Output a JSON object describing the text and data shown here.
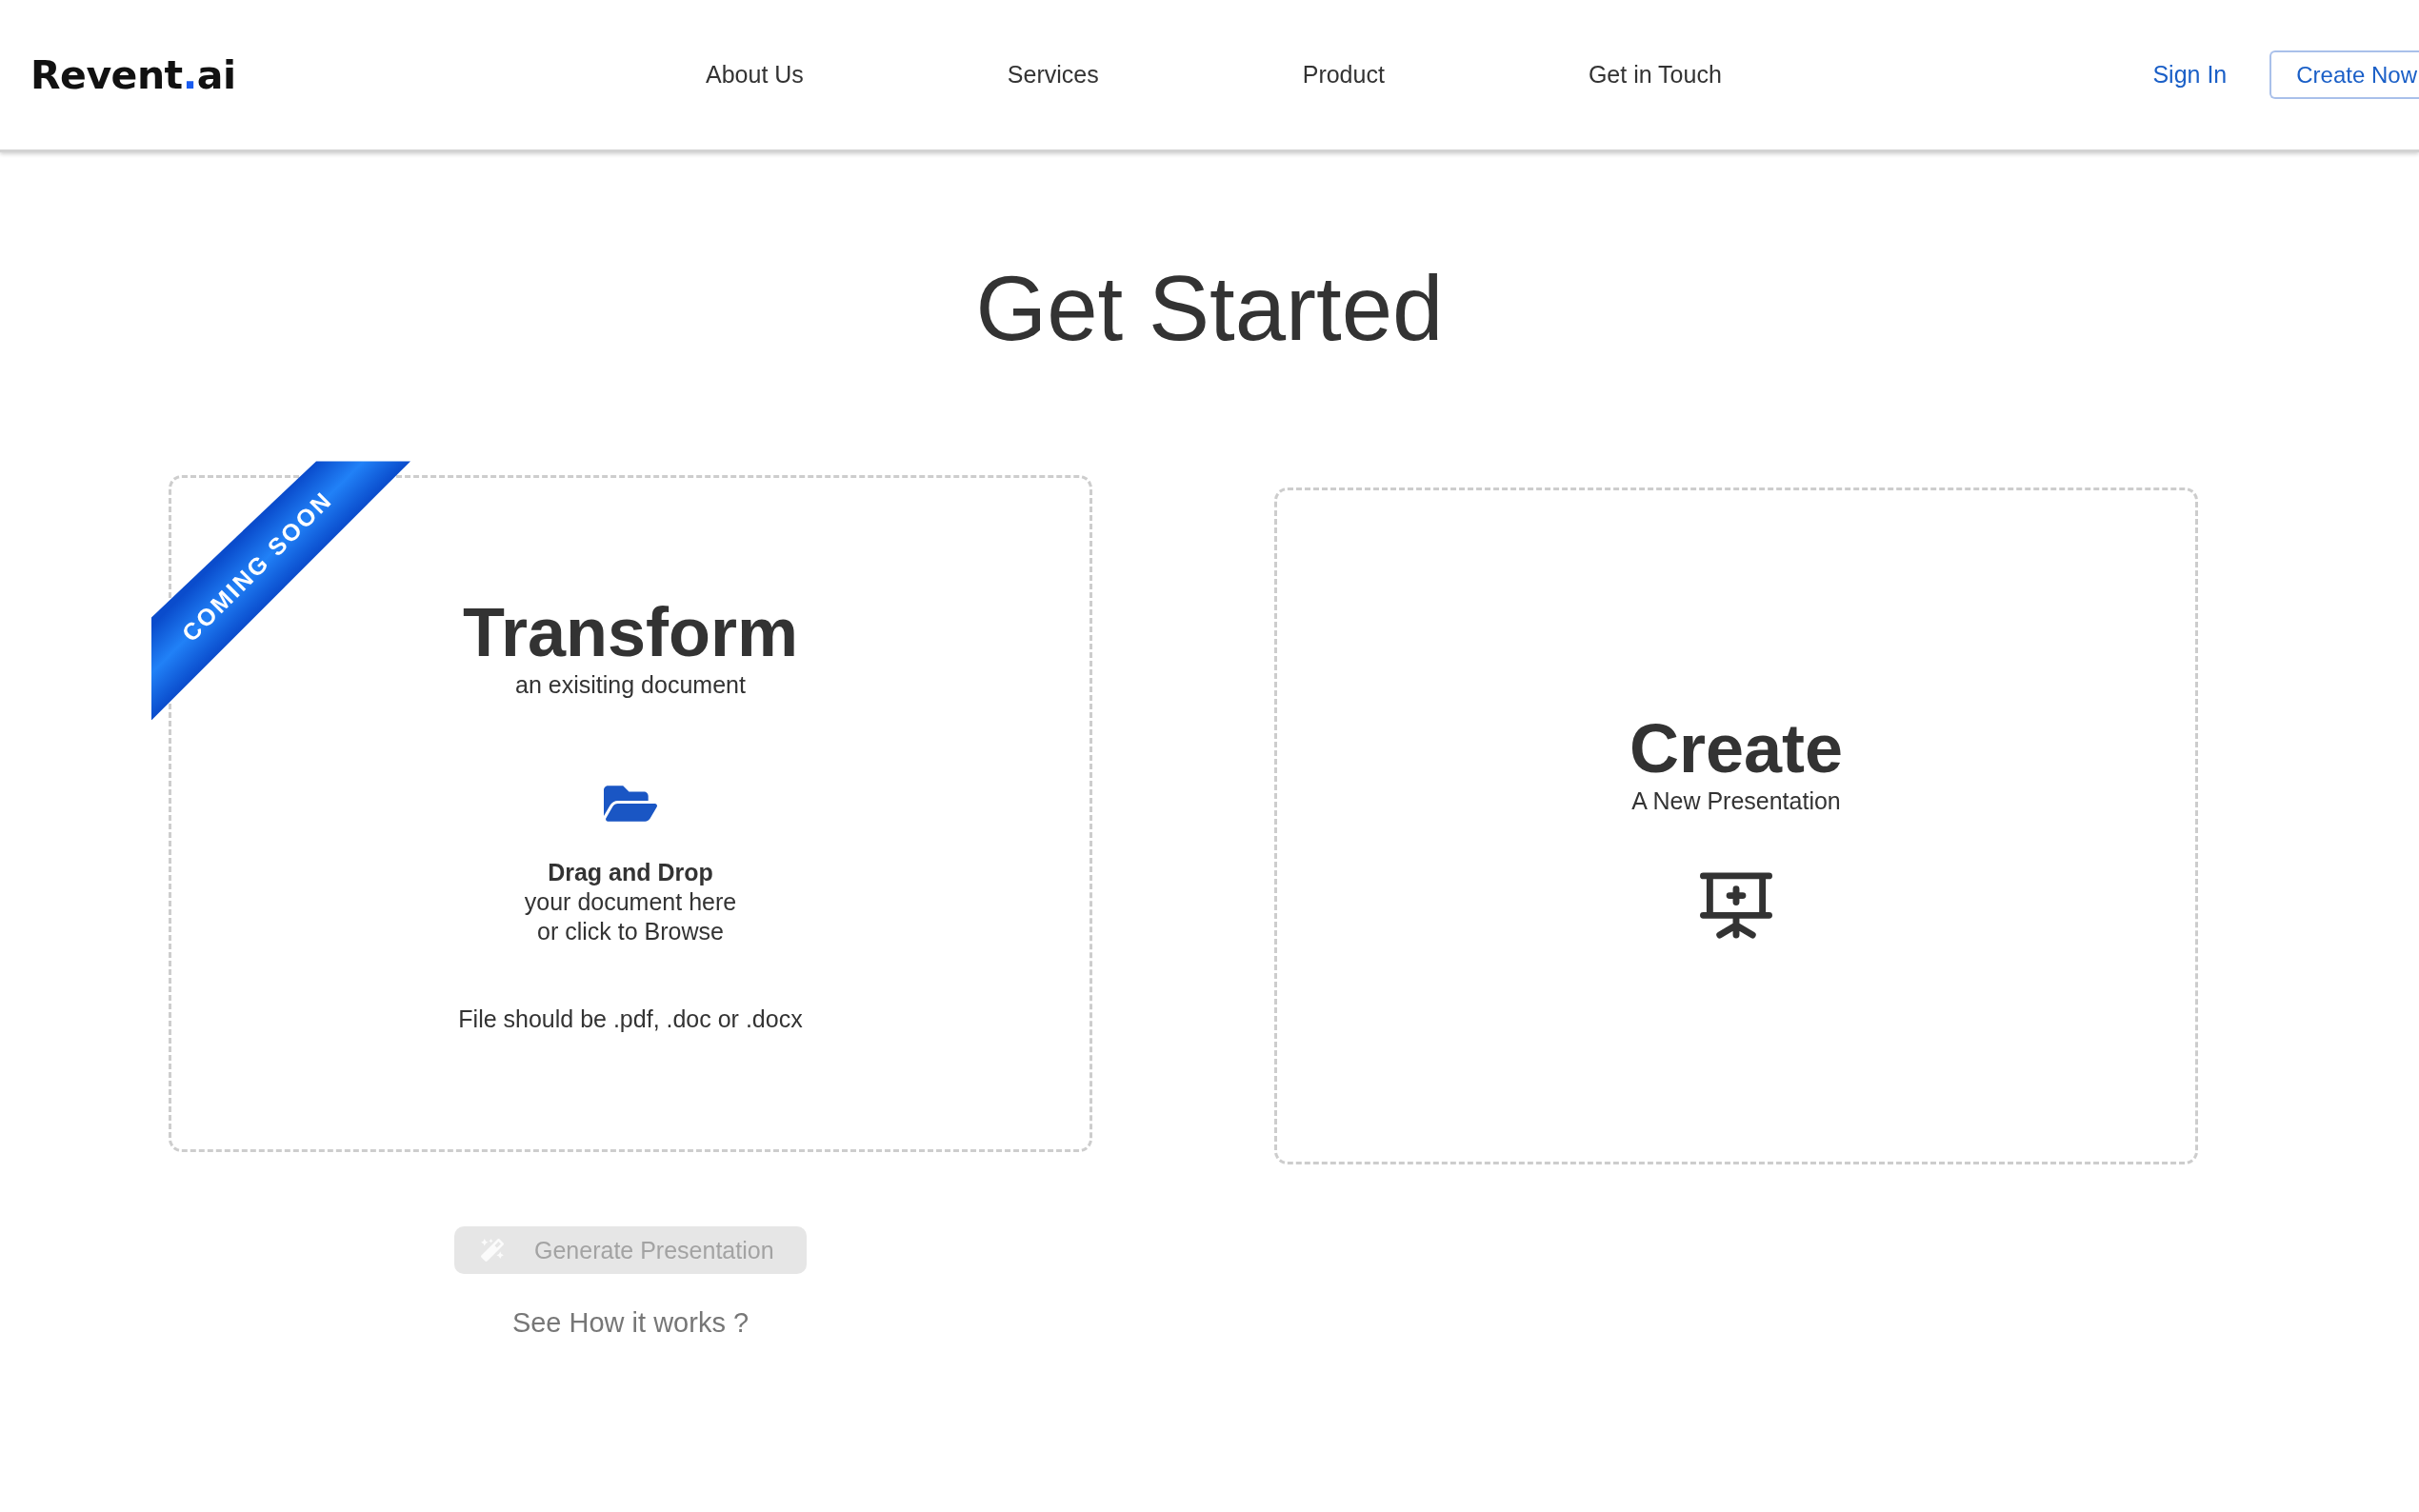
{
  "header": {
    "logo": {
      "name": "Revent",
      "dot": ".",
      "suffix": "ai"
    },
    "nav_links": [
      "About Us",
      "Services",
      "Product",
      "Get in Touch"
    ],
    "sign_in": "Sign In",
    "cta_button": "Create Now"
  },
  "page_title": "Get Started",
  "cards": [
    {
      "kind": "upload",
      "ribbon": "COMING SOON",
      "title": "Transform",
      "subtitle": "an exisiting document",
      "drop_title": "Drag and Drop",
      "drop_lines": [
        "your document here",
        "or click to Browse"
      ],
      "note": "File should be .pdf, .doc or .docx",
      "generate_button": {
        "label": "Generate Presentation",
        "disabled": true
      },
      "help_link": "See How it works ?"
    },
    {
      "kind": "create",
      "title": "Create",
      "subtitle": "A New Presentation"
    }
  ]
}
